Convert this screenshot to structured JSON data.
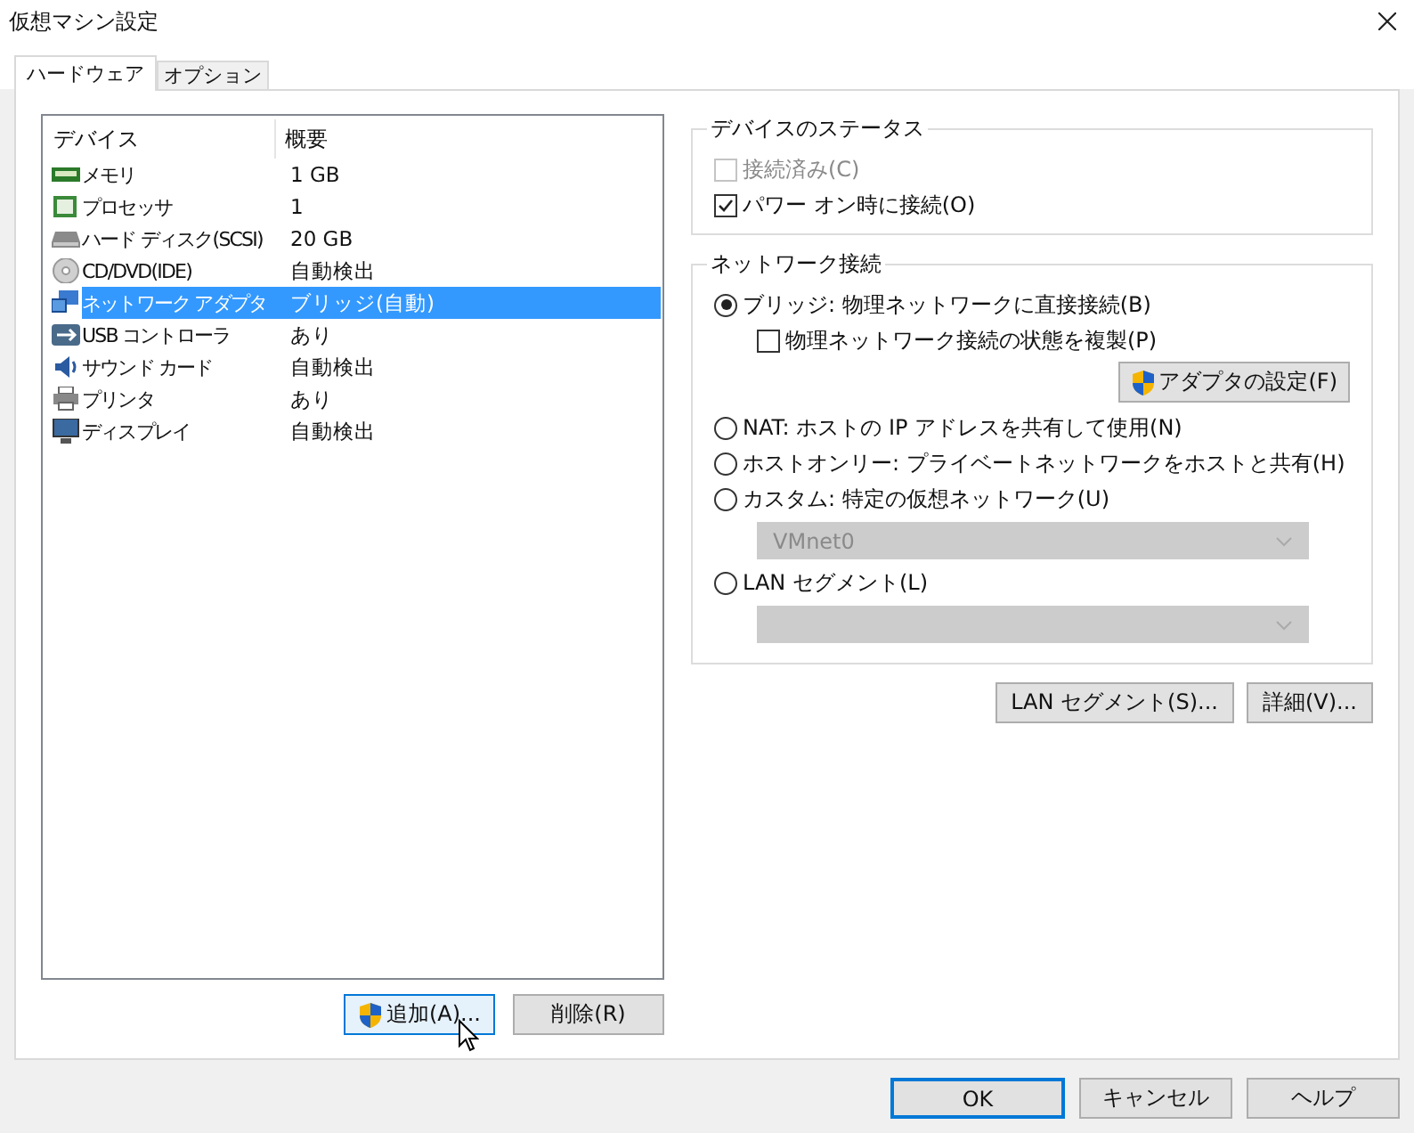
{
  "window": {
    "title": "仮想マシン設定"
  },
  "tabs": [
    {
      "label": "ハードウェア",
      "selected": true
    },
    {
      "label": "オプション",
      "selected": false
    }
  ],
  "device_list": {
    "columns": [
      "デバイス",
      "概要"
    ],
    "rows": [
      {
        "device": "メモリ",
        "summary": "1 GB",
        "selected": false
      },
      {
        "device": "プロセッサ",
        "summary": "1",
        "selected": false
      },
      {
        "device": "ハード ディスク(SCSI)",
        "summary": "20 GB",
        "selected": false
      },
      {
        "device": "CD/DVD(IDE)",
        "summary": "自動検出",
        "selected": false
      },
      {
        "device": "ネットワーク アダプタ",
        "summary": "ブリッジ(自動)",
        "selected": true
      },
      {
        "device": "USB コントローラ",
        "summary": "あり",
        "selected": false
      },
      {
        "device": "サウンド カード",
        "summary": "自動検出",
        "selected": false
      },
      {
        "device": "プリンタ",
        "summary": "あり",
        "selected": false
      },
      {
        "device": "ディスプレイ",
        "summary": "自動検出",
        "selected": false
      }
    ]
  },
  "list_buttons": [
    {
      "label": "追加(A)...",
      "kind": "shield",
      "hovered": true
    },
    {
      "label": "削除(R)",
      "kind": "plain",
      "hovered": false
    }
  ],
  "device_status": {
    "title": "デバイスのステータス",
    "options": [
      {
        "label": "接続済み(C)",
        "checked": false,
        "disabled": true
      },
      {
        "label": "パワー オン時に接続(O)",
        "checked": true,
        "disabled": false
      }
    ]
  },
  "network_connection": {
    "title": "ネットワーク接続",
    "items": [
      {
        "kind": "radio",
        "label": "ブリッジ: 物理ネットワークに直接接続(B)",
        "selected": true
      },
      {
        "kind": "checkbox",
        "label": "物理ネットワーク接続の状態を複製(P)",
        "checked": false
      },
      {
        "kind": "button",
        "label": "アダプタの設定(F)"
      },
      {
        "kind": "radio",
        "label": "NAT: ホストの IP アドレスを共有して使用(N)",
        "selected": false
      },
      {
        "kind": "radio",
        "label": "ホストオンリー: プライベートネットワークをホストと共有(H)",
        "selected": false
      },
      {
        "kind": "radio",
        "label": "カスタム: 特定の仮想ネットワーク(U)",
        "selected": false
      },
      {
        "kind": "dropdown",
        "value": "VMnet0",
        "disabled": true
      },
      {
        "kind": "radio",
        "label": "LAN セグメント(L)",
        "selected": false
      },
      {
        "kind": "dropdown",
        "disabled": true
      }
    ]
  },
  "panel_buttons": [
    "LAN セグメント(S)...",
    "詳細(V)..."
  ],
  "dialog_buttons": [
    {
      "label": "OK",
      "default": true
    },
    {
      "label": "キャンセル",
      "default": false
    },
    {
      "label": "ヘルプ",
      "default": false
    }
  ]
}
